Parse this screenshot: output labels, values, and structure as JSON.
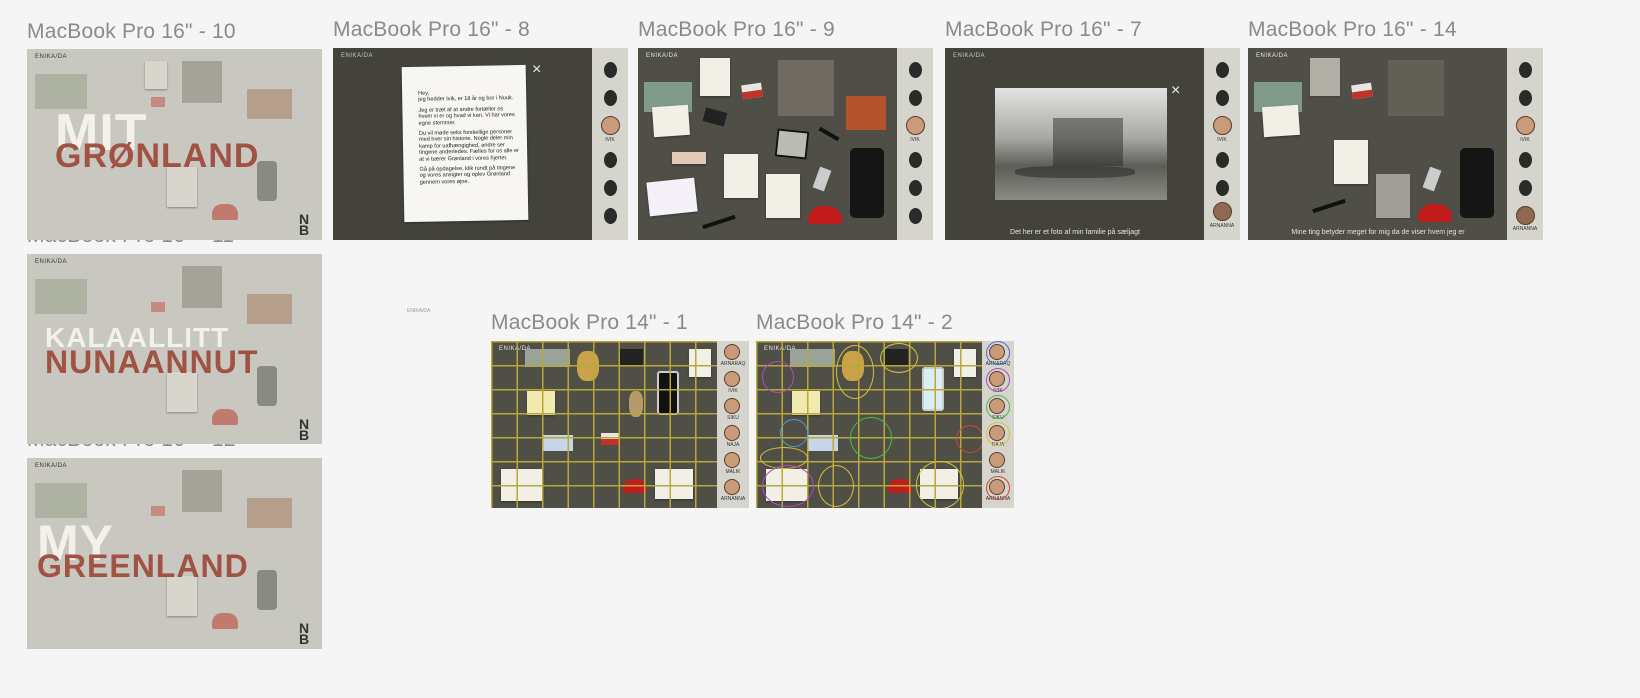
{
  "canvas": {
    "frames": [
      {
        "id": "f10",
        "label": "MacBook Pro 16\" - 10"
      },
      {
        "id": "f8",
        "label": "MacBook Pro 16\" - 8"
      },
      {
        "id": "f9",
        "label": "MacBook Pro 16\" - 9"
      },
      {
        "id": "f7",
        "label": "MacBook Pro 16\" - 7"
      },
      {
        "id": "f14",
        "label": "MacBook Pro 16\" - 14"
      },
      {
        "id": "f11",
        "label": "MacBook Pro 16\" - 11"
      },
      {
        "id": "f12",
        "label": "MacBook Pro 16\" - 12"
      },
      {
        "id": "f14_1",
        "label": "MacBook Pro 14\" - 1"
      },
      {
        "id": "f14_2",
        "label": "MacBook Pro 14\" - 2"
      }
    ],
    "stray_label": "ENIKA/DA"
  },
  "brand": "ENIKA/DA",
  "nb_logo": {
    "top": "N",
    "bottom": "B"
  },
  "titles": {
    "f10": {
      "line1": "MIT",
      "line2": "GRØNLAND"
    },
    "f11": {
      "line1": "KALAALLITT",
      "line2": "NUNAANNUT"
    },
    "f12": {
      "line1": "MY",
      "line2": "GREENLAND"
    }
  },
  "letter": {
    "close_glyph": "×",
    "paragraphs": [
      "Hey,\njeg hedder Ivik, er 18 år og bor i Nuuk.",
      "Jeg er træt af at andre fortæller os hvem vi er og hvad vi kan. Vi har vores egne stemmer.",
      "Du vil møde seks forskellige personer med hver sin historie. Nogle deler min kamp for uafhængighed, andre ser tingene anderledes. Fælles for os alle er at vi bærer Grønland i vores hjerter.",
      "Gå på opdagelse, klik rundt på tingene og vores ansigter og oplev Grønland gennem vores øjne."
    ]
  },
  "photo_view": {
    "close_glyph": "×",
    "caption": "Det her er et foto af min familie på sæljagt"
  },
  "f14_caption": "Mine ting betyder meget for mig da de viser hvem jeg er",
  "people": {
    "ivik": "IVIK",
    "arnanna": "ARNANNA",
    "grid": [
      "ARNARAQ",
      "IVIK",
      "SIKU",
      "NAJA",
      "MALIK",
      "ARNANNA"
    ]
  },
  "colors": {
    "board": "#4f4f47",
    "light_frame": "#c9c8c0",
    "rust": "#a05243",
    "grid_line": "#b8a837",
    "label": "#8a8a8a"
  }
}
